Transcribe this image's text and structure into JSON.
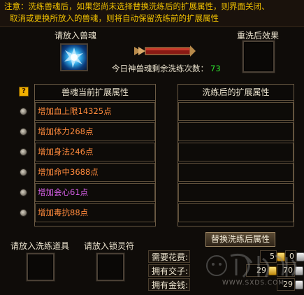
{
  "notice": {
    "line1": "注意：洗练兽魂后，如果您尚未选择替换洗练后的扩展属性，则界面关闭、",
    "line2": "取消或更换所放入的兽魂，则将自动保留洗练前的扩展属性"
  },
  "left_slot": {
    "label": "请放入兽魂"
  },
  "right_slot": {
    "label": "重洗后效果"
  },
  "counter": {
    "label": "今日神兽魂剩余洗练次数：",
    "value": "73"
  },
  "help_icon": "?",
  "current_panel": {
    "title": "兽魂当前扩展属性",
    "rows": [
      {
        "text": "增加血上限14325点",
        "color": "#ff8a3c"
      },
      {
        "text": "增加体力268点",
        "color": "#ff8a3c"
      },
      {
        "text": "增加身法246点",
        "color": "#ff8a3c"
      },
      {
        "text": "增加命中3688点",
        "color": "#ff8a3c"
      },
      {
        "text": "增加会心61点",
        "color": "#d860e8"
      },
      {
        "text": "增加毒抗88点",
        "color": "#ff8a3c"
      }
    ]
  },
  "after_panel": {
    "title": "洗练后的扩展属性"
  },
  "replace_button": "替换洗练后属性",
  "tool_slot": {
    "label": "请放入洗练道具"
  },
  "lock_slot": {
    "label": "请放入锁灵符"
  },
  "costs": {
    "need": {
      "label": "需要花费:",
      "gold": "5",
      "silver": "0"
    },
    "jiaozi": {
      "label": "拥有交子:",
      "gold": "29",
      "silver": "70"
    },
    "money": {
      "label": "拥有金钱:",
      "gold": "",
      "silver": "29"
    }
  },
  "watermark": "WWW.SXDS.COM"
}
